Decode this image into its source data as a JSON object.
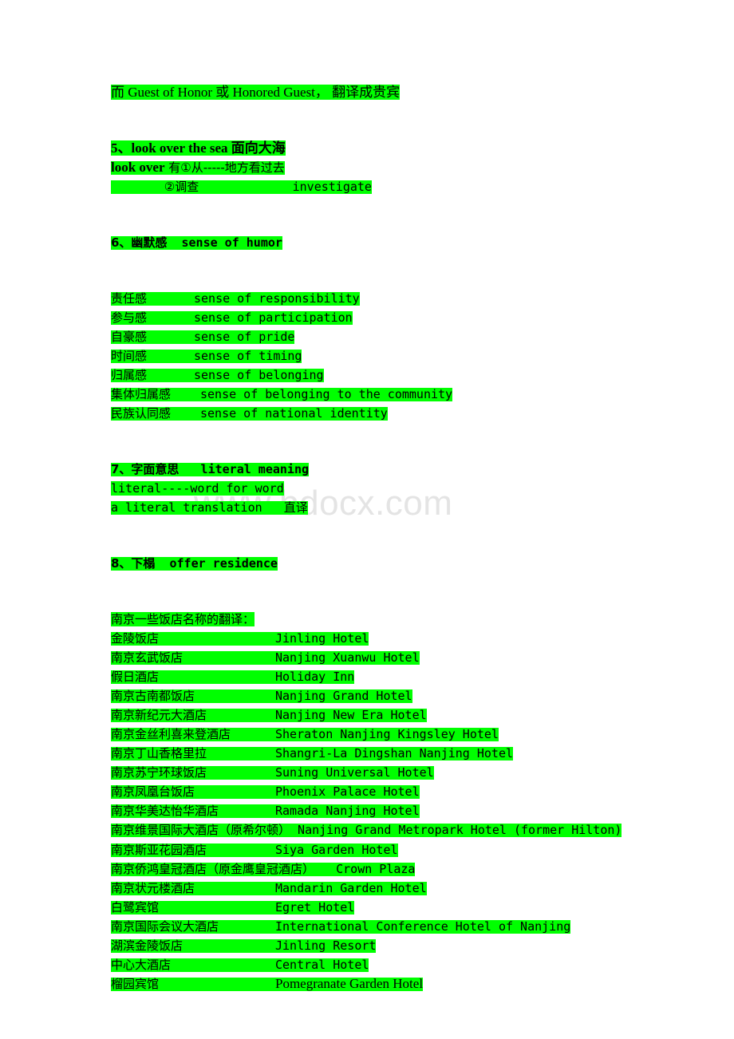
{
  "document": {
    "watermark": "www.bdocx.com",
    "highlight_color": "#00ff00",
    "background_color": "#ffffff",
    "text_color": "#000000",
    "watermark_color": "#e4e4e4"
  },
  "sections": {
    "guest_line": {
      "text": "而   Guest of Honor 或  Honored Guest，  翻译成贵宾"
    },
    "item5": {
      "heading": "5、look over the sea   面向大海",
      "line1_label": "look over",
      "line1_text": " 有①从-----地方看过去",
      "line2_num": "②调查",
      "line2_en": "investigate"
    },
    "item6": {
      "heading_cn": "6、幽默感",
      "heading_en": "sense of humor",
      "rows": [
        {
          "cn": "责任感",
          "en": "sense of responsibility"
        },
        {
          "cn": "参与感",
          "en": "sense of participation"
        },
        {
          "cn": "自豪感",
          "en": "sense of pride"
        },
        {
          "cn": "时间感",
          "en": "sense of timing"
        },
        {
          "cn": "归属感",
          "en": "sense of belonging"
        },
        {
          "cn": "集体归属感",
          "en": "sense of belonging to the community"
        },
        {
          "cn": "民族认同感",
          "en": "sense of national identity"
        }
      ]
    },
    "item7": {
      "heading_cn": "7、字面意思",
      "heading_en": "literal meaning",
      "line1": "literal----word for word",
      "line2_en": "a literal translation",
      "line2_cn": "直译"
    },
    "item8": {
      "heading_cn": "8、下榻",
      "heading_en": "offer residence",
      "list_title": "南京一些饭店名称的翻译：",
      "hotels": [
        {
          "cn": "金陵饭店",
          "en": "Jinling Hotel"
        },
        {
          "cn": "南京玄武饭店",
          "en": "Nanjing Xuanwu Hotel"
        },
        {
          "cn": "假日酒店",
          "en": "Holiday Inn"
        },
        {
          "cn": "南京古南都饭店",
          "en": "Nanjing Grand Hotel"
        },
        {
          "cn": "南京新纪元大酒店",
          "en": "Nanjing New Era Hotel"
        },
        {
          "cn": "南京金丝利喜来登酒店",
          "en": "Sheraton Nanjing Kingsley Hotel"
        },
        {
          "cn": "南京丁山香格里拉",
          "en": "Shangri-La Dingshan Nanjing Hotel"
        },
        {
          "cn": "南京苏宁环球饭店",
          "en": "Suning Universal Hotel"
        },
        {
          "cn": "南京凤凰台饭店",
          "en": "Phoenix Palace Hotel"
        },
        {
          "cn": "南京华美达怡华酒店",
          "en": "Ramada Nanjing Hotel"
        },
        {
          "cn": "南京维景国际大酒店（原希尔顿）",
          "en": "Nanjing Grand Metropark Hotel (former Hilton)"
        },
        {
          "cn": "南京斯亚花园酒店",
          "en": "Siya Garden Hotel"
        },
        {
          "cn": "南京侨鸿皇冠酒店（原金鹰皇冠酒店）",
          "en": "Crown Plaza"
        },
        {
          "cn": "南京状元楼酒店",
          "en": "Mandarin Garden Hotel"
        },
        {
          "cn": "白鹭宾馆",
          "en": "Egret Hotel"
        },
        {
          "cn": "南京国际会议大酒店",
          "en": "International Conference Hotel of Nanjing"
        },
        {
          "cn": "湖滨金陵饭店",
          "en": "Jinling Resort"
        },
        {
          "cn": "中心大酒店",
          "en": "Central Hotel"
        },
        {
          "cn": "榴园宾馆",
          "en": "Pomegranate Garden Hotel"
        }
      ]
    }
  }
}
